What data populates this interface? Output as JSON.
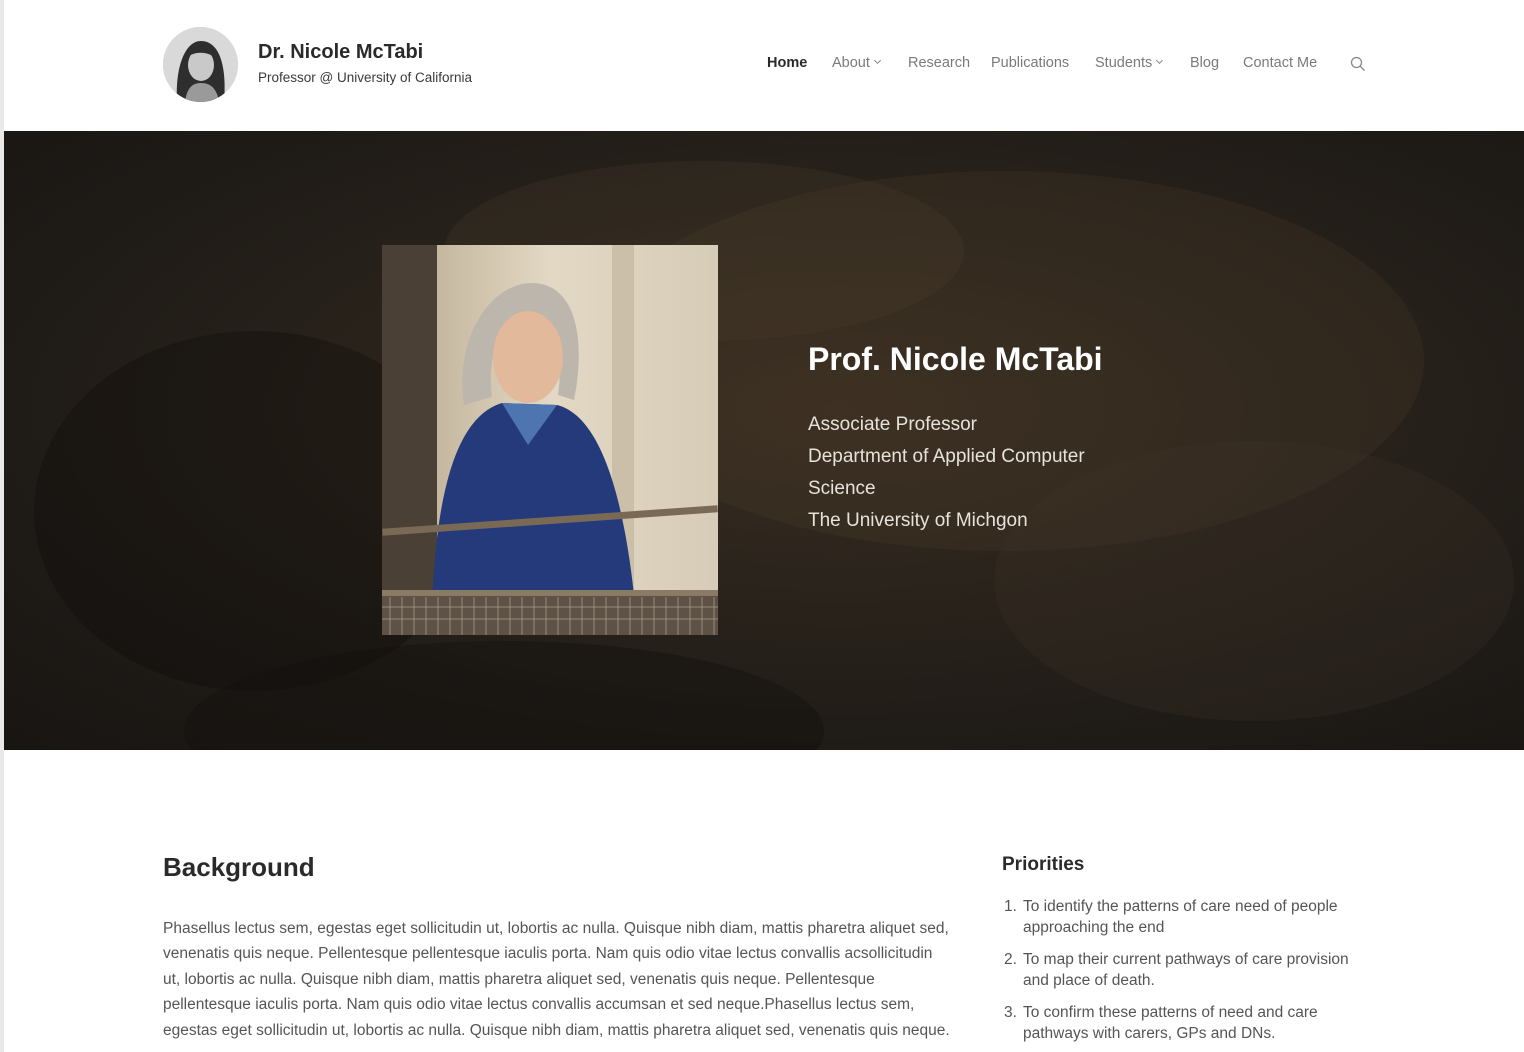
{
  "header": {
    "title": "Dr. Nicole McTabi",
    "tagline": "Professor @ University of California"
  },
  "nav": {
    "items": [
      {
        "label": "Home",
        "active": true,
        "dropdown": false
      },
      {
        "label": "About",
        "active": false,
        "dropdown": true
      },
      {
        "label": "Research",
        "active": false,
        "dropdown": false
      },
      {
        "label": "Publications",
        "active": false,
        "dropdown": false
      },
      {
        "label": "Students",
        "active": false,
        "dropdown": true
      },
      {
        "label": "Blog",
        "active": false,
        "dropdown": false
      },
      {
        "label": "Contact Me",
        "active": false,
        "dropdown": false
      }
    ],
    "search_icon": "search-icon"
  },
  "hero": {
    "name": "Prof. Nicole McTabi",
    "lines": [
      "Associate Professor",
      "Department of Applied Computer",
      "Science",
      "The University of Michgon"
    ]
  },
  "background": {
    "heading": "Background",
    "lines": [
      "Phasellus lectus sem, egestas eget sollicitudin ut, lobortis ac nulla. Quisque nibh diam, mattis pharetra aliquet sed,",
      "venenatis quis neque. Pellentesque pellentesque iaculis porta. Nam quis odio vitae lectus convallis acsollicitudin",
      "ut, lobortis ac nulla. Quisque nibh diam, mattis pharetra aliquet sed, venenatis quis neque. Pellentesque",
      "pellentesque iaculis porta. Nam quis odio vitae lectus convallis accumsan et sed neque.Phasellus lectus sem,",
      "egestas eget sollicitudin ut, lobortis ac nulla. Quisque nibh diam, mattis pharetra aliquet sed, venenatis quis neque."
    ]
  },
  "priorities": {
    "heading": "Priorities",
    "items": [
      {
        "num": "1.",
        "lines": [
          "To identify the patterns of care need of people",
          "approaching the end"
        ]
      },
      {
        "num": "2.",
        "lines": [
          "To map their current pathways of care provision",
          "and place of death."
        ]
      },
      {
        "num": "3.",
        "lines": [
          "To confirm these patterns of need and care",
          "pathways with carers, GPs and DNs."
        ]
      }
    ]
  },
  "colors": {
    "hero_bg": "#211c17",
    "text_dark": "#2a2a2a",
    "text_muted": "#555555",
    "nav_muted": "#7a7a7a"
  }
}
